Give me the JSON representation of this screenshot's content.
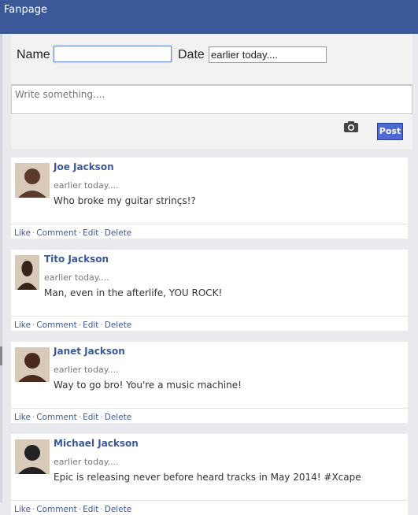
{
  "header": {
    "title": "Fanpage"
  },
  "form": {
    "name_label": "Name",
    "name_value": "",
    "date_label": "Date",
    "date_value": "earlier today....",
    "write_placeholder": "Write something....",
    "post_label": "Post",
    "camera_icon": "camera-icon"
  },
  "posts": [
    {
      "author": "Joe Jackson",
      "time": "earlier today....",
      "message": "Who broke my guitar strinçs!?",
      "avatar_color": "#5a3a2a"
    },
    {
      "author": "Tito Jackson",
      "time": "earlier today....",
      "message": "Man, even in the afterlife, YOU ROCK!",
      "avatar_color": "#3a2418"
    },
    {
      "author": "Janet Jackson",
      "time": "earlier today....",
      "message": "Way to go bro! You're a music machine!",
      "avatar_color": "#4a2a1c"
    },
    {
      "author": "Michael Jackson",
      "time": "earlier today....",
      "message": "Epic is releasing never before heard tracks in May 2014! #Xcape",
      "avatar_color": "#222222"
    }
  ],
  "actions": {
    "like": "Like",
    "comment": "Comment",
    "edit": "Edit",
    "delete": "Delete",
    "separator": "·"
  },
  "colors": {
    "brand": "#3b5998",
    "post_button": "#4e69d6",
    "background": "#e9eaed"
  }
}
